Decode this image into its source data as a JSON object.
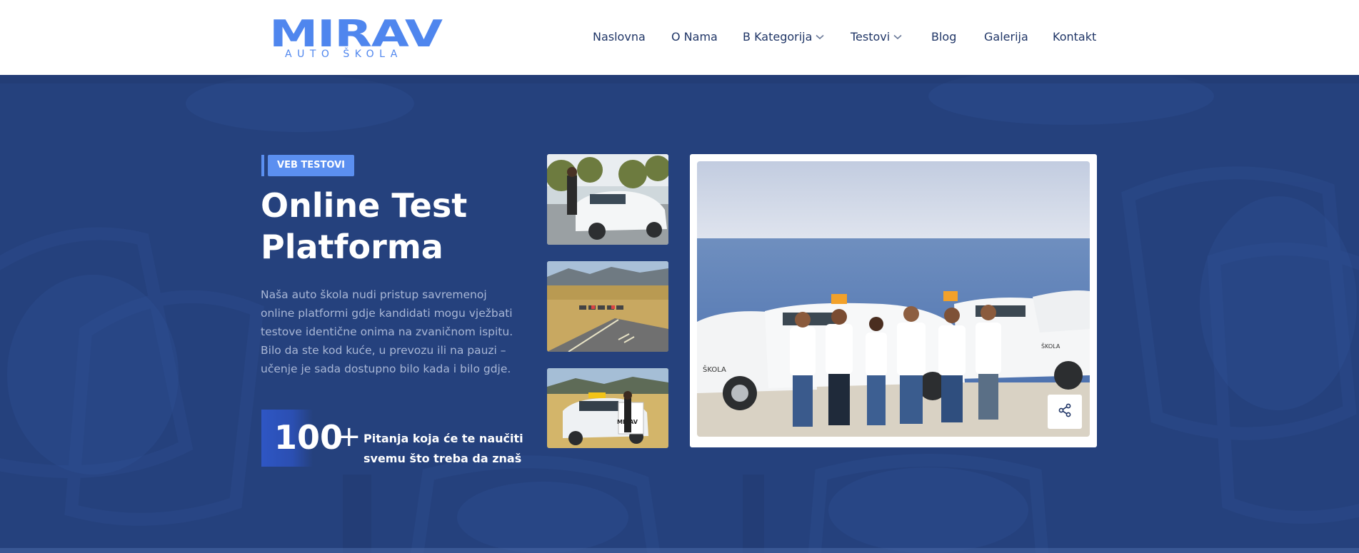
{
  "brand": {
    "name": "MIRAV",
    "tagline": "AUTO ŠKOLA",
    "color": "#4f86ee"
  },
  "nav": {
    "items": [
      {
        "label": "Naslovna",
        "has_dropdown": false
      },
      {
        "label": "O Nama",
        "has_dropdown": false
      },
      {
        "label": "B Kategorija",
        "has_dropdown": true
      },
      {
        "label": "Testovi",
        "has_dropdown": true
      },
      {
        "label": "Blog",
        "has_dropdown": false
      },
      {
        "label": "Galerija",
        "has_dropdown": false
      },
      {
        "label": "Kontakt",
        "has_dropdown": false
      }
    ],
    "text_color": "#1f3566"
  },
  "hero": {
    "badge": "VEB TESTOVI",
    "title_line1": "Online Test",
    "title_line2": "Platforma",
    "description": "Naša auto škola nudi pristup savremenoj online platformi gdje kandidati mogu vježbati testove identične onima na zvaničnom ispitu. Bilo da ste kod kuće, u prevozu ili na pauzi – učenje je sada dostupno bilo kada i bilo gdje.",
    "stat": {
      "number": "100",
      "suffix": "+",
      "text_line1": "Pitanja koja će te naučiti",
      "text_line2": "svemu što treba da znaš"
    },
    "background_color": "#25417d",
    "accent_color": "#5b8ff0"
  },
  "gallery": {
    "thumbnails": [
      {
        "alt": "Kandidatkinja pored automobila auto škole"
      },
      {
        "alt": "Poligon sa automobilima"
      },
      {
        "alt": "Kandidatkinja u automobilu MIRAV"
      }
    ],
    "main_image_alt": "Tim auto škole MIRAV ispred automobila pored mora",
    "share_icon": "share-icon"
  }
}
